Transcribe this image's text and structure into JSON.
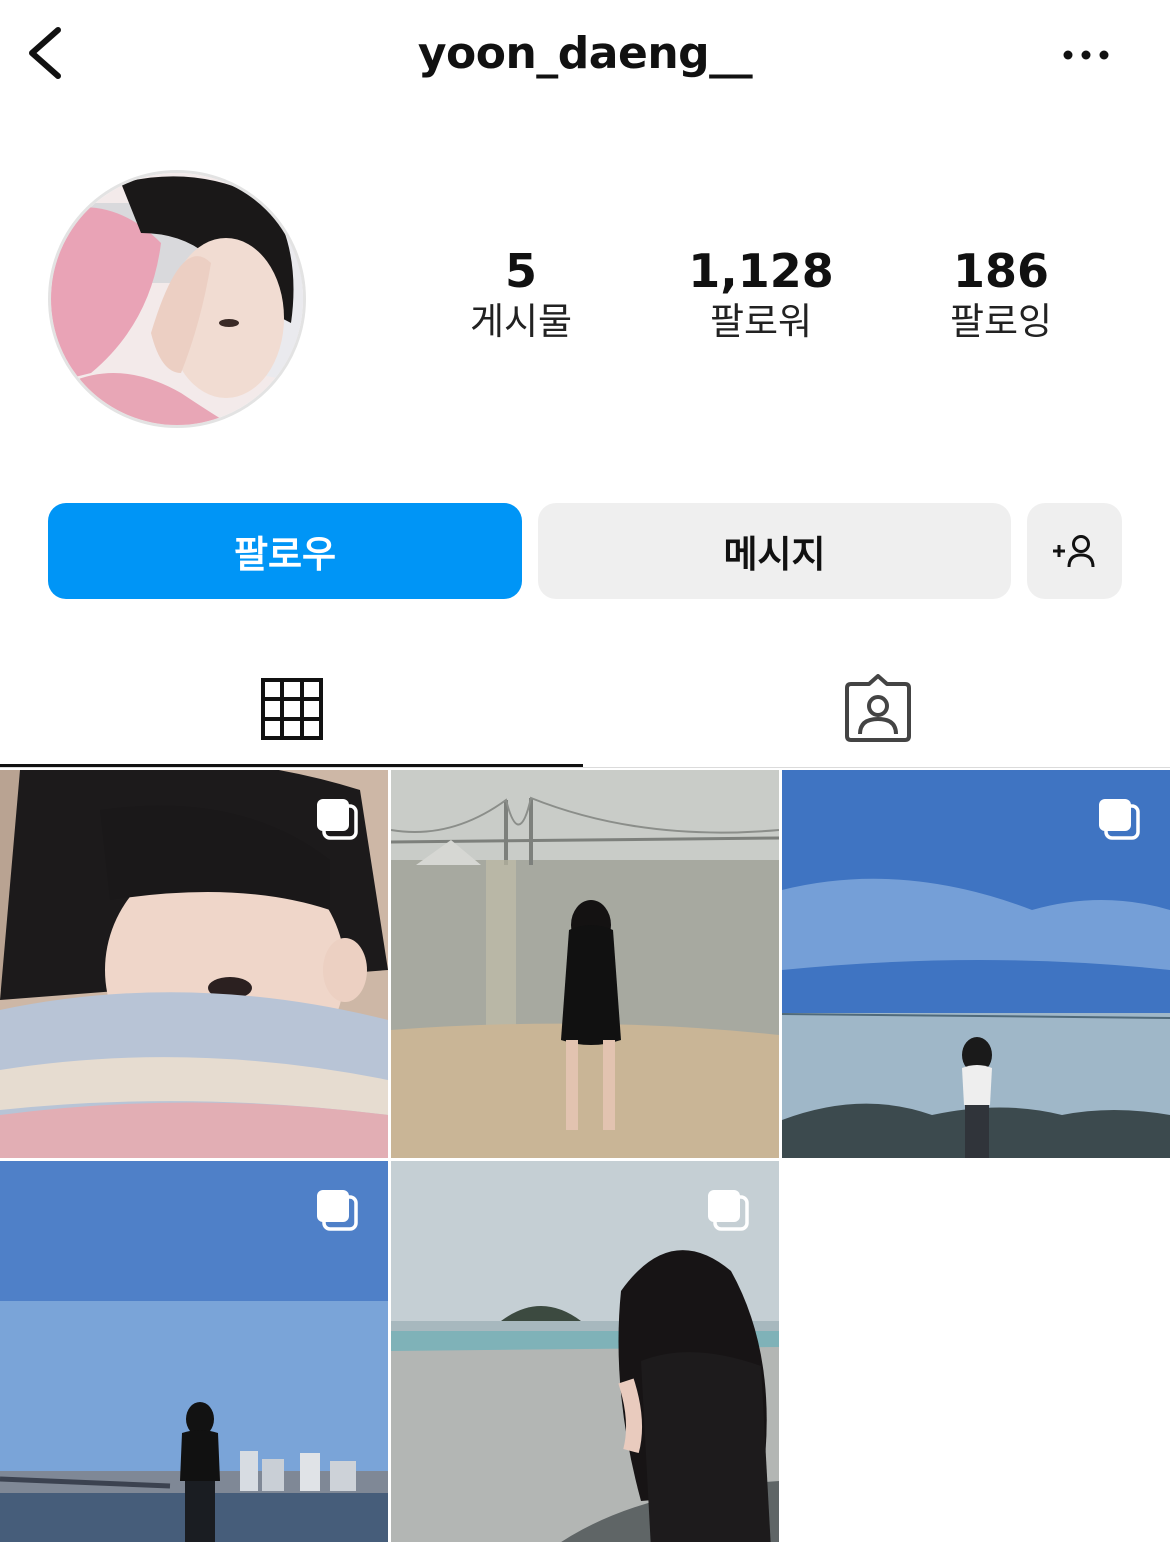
{
  "header": {
    "username": "yoon_daeng__",
    "back_icon": "chevron-left-icon",
    "more_icon": "more-horizontal-icon"
  },
  "profile": {
    "avatar": "profile-photo"
  },
  "stats": [
    {
      "value": "5",
      "label": "게시물"
    },
    {
      "value": "1,128",
      "label": "팔로워"
    },
    {
      "value": "186",
      "label": "팔로잉"
    }
  ],
  "actions": {
    "follow_label": "팔로우",
    "message_label": "메시지",
    "add_person_icon": "add-person-icon"
  },
  "colors": {
    "accent": "#0095f6",
    "button_bg": "#efefef",
    "text": "#111111"
  },
  "tabs": [
    {
      "icon": "grid-icon",
      "active": true
    },
    {
      "icon": "tagged-person-icon",
      "active": false
    }
  ],
  "posts": [
    {
      "subject": "selfie-with-blanket",
      "multi": true
    },
    {
      "subject": "beach-bridge",
      "multi": false
    },
    {
      "subject": "sea-blue-sky",
      "multi": true
    },
    {
      "subject": "river-city",
      "multi": true
    },
    {
      "subject": "island-view",
      "multi": true
    }
  ]
}
